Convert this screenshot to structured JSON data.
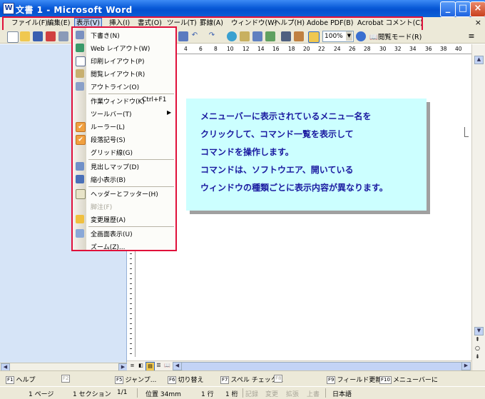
{
  "window": {
    "title": "文書 1 - Microsoft Word",
    "icon": "word-doc-icon",
    "controls": [
      "minimize-icon",
      "maximize-icon",
      "close-icon"
    ]
  },
  "menubar": {
    "items": [
      {
        "label": "ファイル(F)"
      },
      {
        "label": "編集(E)"
      },
      {
        "label": "表示(V)",
        "active": true
      },
      {
        "label": "挿入(I)"
      },
      {
        "label": "書式(O)"
      },
      {
        "label": "ツール(T)"
      },
      {
        "label": "罫線(A)"
      },
      {
        "label": "ウィンドウ(W)"
      },
      {
        "label": "ヘルプ(H)"
      },
      {
        "label": "Adobe PDF(B)"
      },
      {
        "label": "Acrobat コメント(C)"
      }
    ],
    "close": "×"
  },
  "toolbar": {
    "zoom": "100%",
    "read_mode": "閲覧モード(R)"
  },
  "view_menu": {
    "items": [
      {
        "label": "下書き(N)",
        "icon": "draft-view-icon"
      },
      {
        "label": "Web レイアウト(W)",
        "icon": "web-layout-icon"
      },
      {
        "label": "印刷レイアウト(P)",
        "icon": "print-layout-icon"
      },
      {
        "label": "閲覧レイアウト(R)",
        "icon": "reading-layout-icon"
      },
      {
        "label": "アウトライン(O)",
        "icon": "outline-view-icon"
      },
      {
        "label": "作業ウィンドウ(K)",
        "shortcut": "Ctrl+F1"
      },
      {
        "label": "ツールバー(T)",
        "submenu": "▶"
      },
      {
        "label": "ルーラー(L)",
        "checked": true
      },
      {
        "label": "段落記号(S)",
        "checked": true
      },
      {
        "label": "グリッド線(G)"
      },
      {
        "label": "見出しマップ(D)",
        "icon": "document-map-icon"
      },
      {
        "label": "縮小表示(B)",
        "icon": "thumbnails-icon"
      },
      {
        "label": "ヘッダーとフッター(H)",
        "icon": "header-footer-icon"
      },
      {
        "label": "脚注(F)",
        "disabled": true
      },
      {
        "label": "変更履歴(A)",
        "icon": "track-changes-icon"
      },
      {
        "label": "全画面表示(U)",
        "icon": "full-screen-icon"
      },
      {
        "label": "ズーム(Z)..."
      }
    ]
  },
  "ruler": {
    "numbers": [
      "4",
      "6",
      "8",
      "10",
      "12",
      "14",
      "16",
      "18",
      "20",
      "22",
      "24",
      "26",
      "28",
      "30",
      "32",
      "34",
      "36",
      "38",
      "40"
    ]
  },
  "callout": {
    "lines": [
      "メニューバーに表示されているメニュー名を",
      "クリックして、コマンド一覧を表示して",
      "コマンドを操作します。",
      "コマンドは、ソフトウエア、開いている",
      "ウィンドウの種類ごとに表示内容が異なります。"
    ]
  },
  "function_keys": [
    {
      "key": "F1",
      "label": "ヘルプ"
    },
    {
      "key": "F2",
      "label": ""
    },
    {
      "key": "F5",
      "label": "ジャンプ..."
    },
    {
      "key": "F6",
      "label": "切り替え"
    },
    {
      "key": "F7",
      "label": "スペル チェック..."
    },
    {
      "key": "F8",
      "label": ""
    },
    {
      "key": "F9",
      "label": "フィールド更新"
    },
    {
      "key": "F10",
      "label": "メニューバーに"
    }
  ],
  "statusbar": {
    "page": "1 ページ",
    "section": "1 セクション",
    "pages": "1/1",
    "position": "位置 34mm",
    "line": "1 行",
    "column": "1 桁",
    "rec": "記録",
    "trk": "変更",
    "ext": "拡張",
    "ovr": "上書",
    "language": "日本語"
  }
}
